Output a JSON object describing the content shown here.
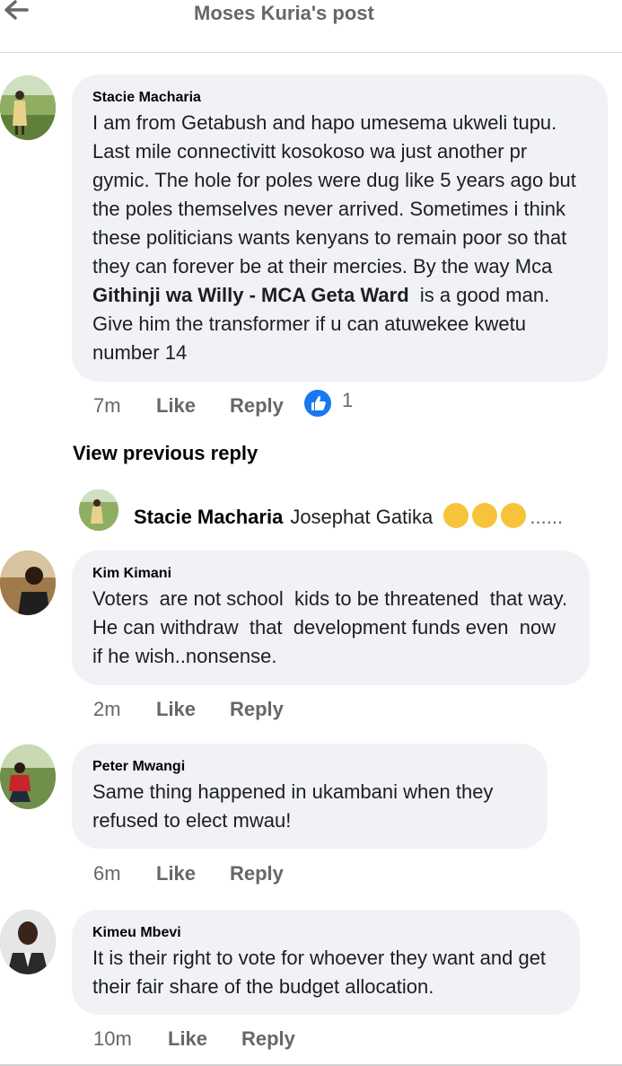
{
  "header": {
    "title": "Moses Kuria's post"
  },
  "comments": [
    {
      "author": "Stacie Macharia",
      "text_before": "I am from Getabush and hapo umesema ukweli tupu. Last mile connectivitt kosokoso wa just another pr gymic. The hole for poles were dug like 5 years ago but the poles themselves never arrived. Sometimes i think these politicians wants kenyans to remain poor so that they can forever be at their mercies. By the way Mca ",
      "mention": "Githinji wa Willy - MCA Geta Ward",
      "text_after": "  is a good man. Give him the transformer if u can atuwekee kwetu number 14",
      "time": "7m",
      "like_label": "Like",
      "reply_label": "Reply",
      "reaction_count": "1",
      "reaction_icon": "thumbs-up-icon"
    },
    {
      "author": "Kim Kimani",
      "text": "Voters  are not school  kids to be threatened  that way. He can withdraw  that  development funds even  now if he wish..nonsense.",
      "time": "2m",
      "like_label": "Like",
      "reply_label": "Reply"
    },
    {
      "author": "Peter Mwangi",
      "text": "Same thing happened in ukambani when they refused to elect mwau!",
      "time": "6m",
      "like_label": "Like",
      "reply_label": "Reply"
    },
    {
      "author": "Kimeu Mbevi",
      "text": "It is their right to vote for whoever they want and get their fair share of the budget allocation.",
      "time": "10m",
      "like_label": "Like",
      "reply_label": "Reply"
    }
  ],
  "view_previous": "View previous reply",
  "reply_preview": {
    "author": "Stacie Macharia",
    "text": "Josephat Gatika",
    "emoji": "rolling-on-floor-laughing-emoji",
    "ellipsis": "......"
  },
  "colors": {
    "bubble": "#f0f2f5",
    "secondary_text": "#65676b",
    "like_blue": "#1877f2"
  }
}
